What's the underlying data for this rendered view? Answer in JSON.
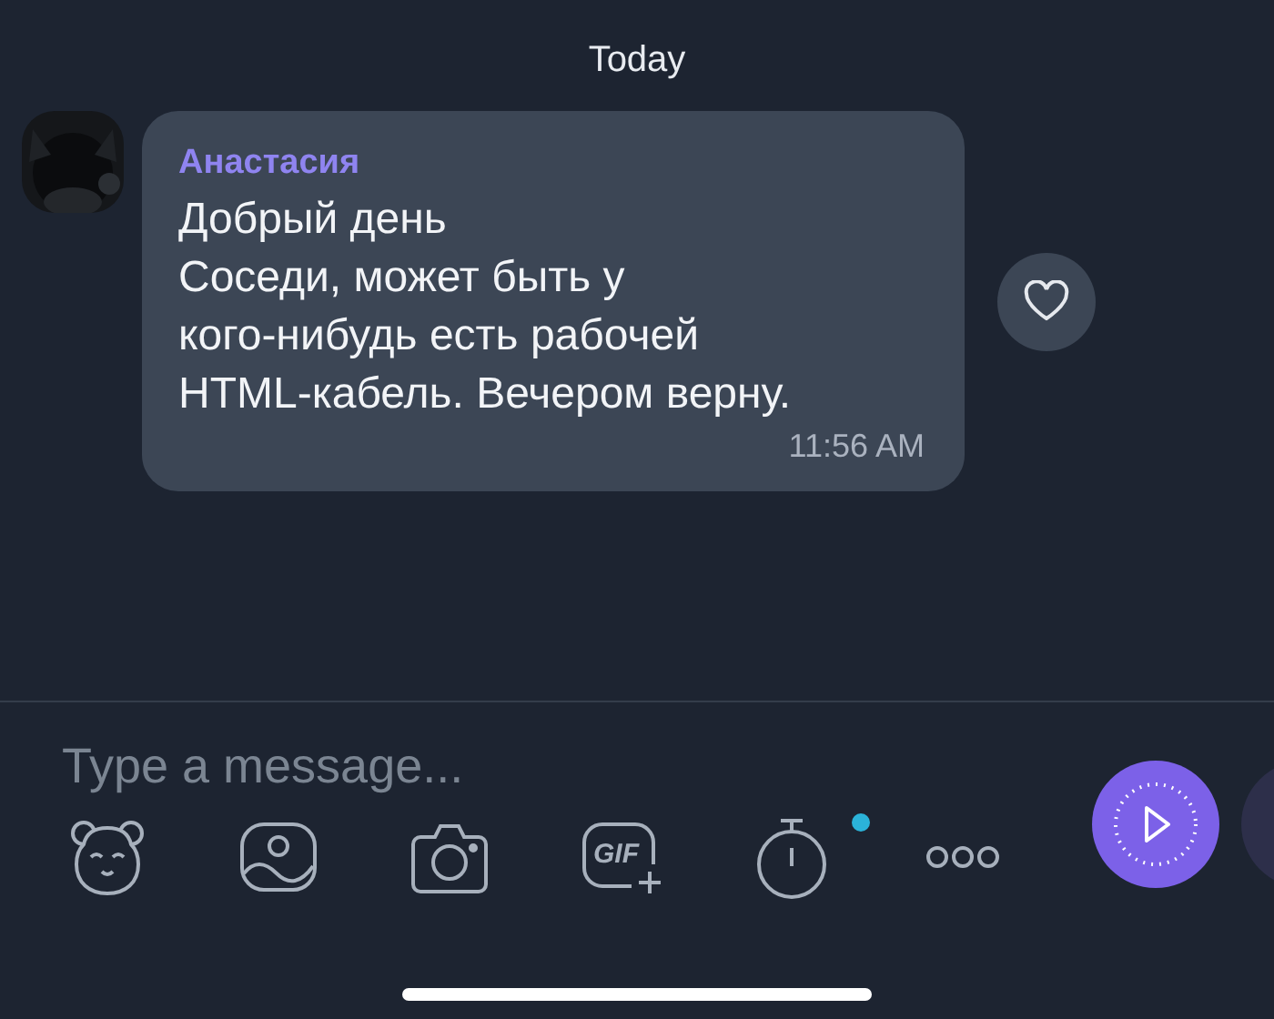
{
  "date_divider": "Today",
  "message": {
    "author": "Анастасия",
    "lines": [
      "Добрый день",
      "Соседи, может быть у",
      "кого-нибудь есть рабочей",
      "HTML-кабель. Вечером верну."
    ],
    "time": "11:56 AM",
    "liked": false
  },
  "composer": {
    "placeholder": "Type a message..."
  },
  "toolbar": [
    {
      "kind": "sticker",
      "badge": false
    },
    {
      "kind": "gallery",
      "badge": false
    },
    {
      "kind": "camera",
      "badge": false
    },
    {
      "kind": "gif",
      "label": "GIF",
      "badge": false
    },
    {
      "kind": "timer",
      "badge": true
    },
    {
      "kind": "more",
      "badge": false
    }
  ]
}
